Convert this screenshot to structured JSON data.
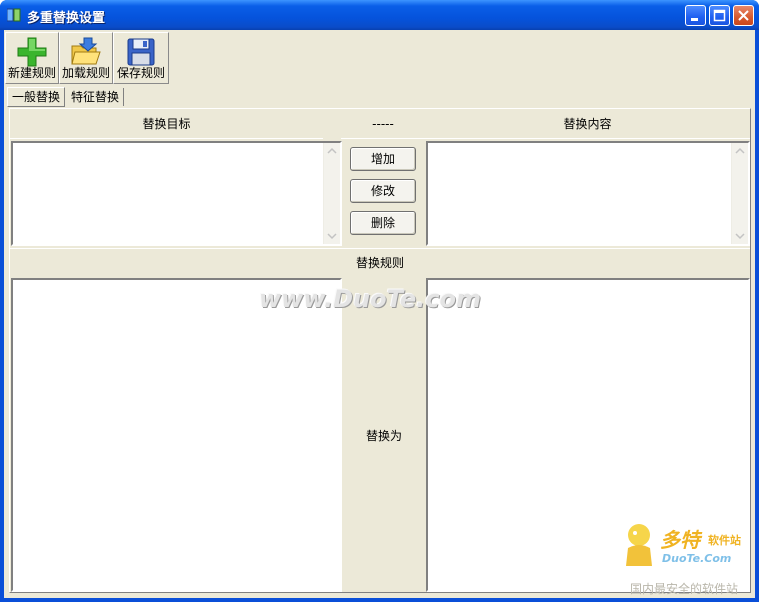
{
  "window": {
    "title": "多重替换设置"
  },
  "toolbar": {
    "new_label": "新建规则",
    "load_label": "加载规则",
    "save_label": "保存规则"
  },
  "tabs": [
    {
      "label": "一般替换",
      "active": true
    },
    {
      "label": "特征替换",
      "active": false
    }
  ],
  "panel": {
    "target_header": "替换目标",
    "middle_header": "-----",
    "content_header": "替换内容",
    "add_button": "增加",
    "modify_button": "修改",
    "delete_button": "删除",
    "rules_header": "替换规则",
    "replace_with": "替换为"
  },
  "watermarks": {
    "site": "www.DuoTe.com",
    "brand": "多特",
    "brand_sub": "软件站",
    "brand_url": "DuoTe.Com",
    "slogan": "国内最安全的软件站"
  }
}
